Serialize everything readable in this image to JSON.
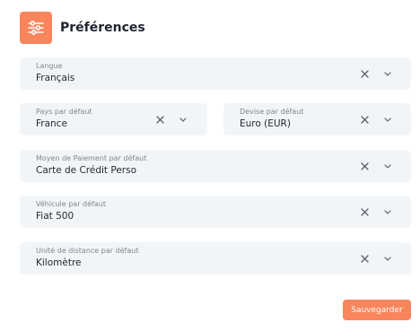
{
  "header": {
    "title": "Préférences",
    "icon": "sliders-icon",
    "icon_bg": "#f9855d"
  },
  "fields": {
    "langue": {
      "label": "Langue",
      "value": "Français"
    },
    "pays": {
      "label": "Pays par défaut",
      "value": "France"
    },
    "devise": {
      "label": "Devise par défaut",
      "value": "Euro (EUR)"
    },
    "paiement": {
      "label": "Moyen de Paiement par défaut",
      "value": "Carte de Crédit Perso"
    },
    "vehicule": {
      "label": "Véhicule par défaut",
      "value": "Fiat 500"
    },
    "distance": {
      "label": "Unité de distance par défaut",
      "value": "Kilomètre"
    }
  },
  "actions": {
    "save_label": "Sauvegarder"
  },
  "colors": {
    "accent": "#f9855d",
    "field_bg": "#f2f5f8",
    "label": "#7f858f"
  }
}
